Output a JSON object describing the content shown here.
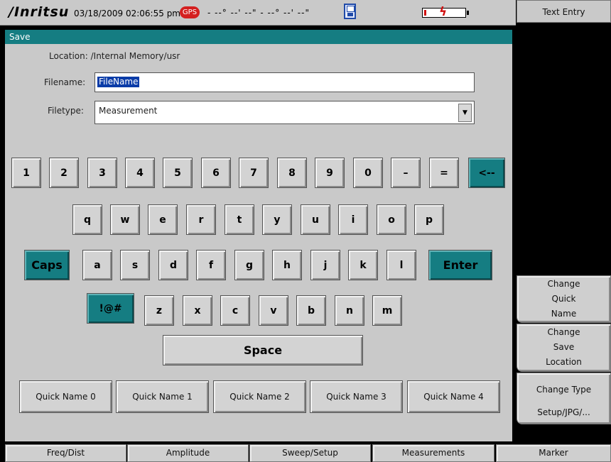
{
  "status_bar": {
    "brand": "/Inritsu",
    "datetime": "03/18/2009 02:06:55 pm",
    "gps_badge": "GPS",
    "coordinates": "- --° --' --\" - --° --' --\""
  },
  "dialog": {
    "title": "Save",
    "location": "Location: /Internal Memory/usr",
    "filename_label": "Filename:",
    "filename_value": "FileName",
    "filetype_label": "Filetype:",
    "filetype_value": "Measurement"
  },
  "keyboard": {
    "row1": [
      "1",
      "2",
      "3",
      "4",
      "5",
      "6",
      "7",
      "8",
      "9",
      "0",
      "–",
      "=",
      "<--"
    ],
    "row2": [
      "q",
      "w",
      "e",
      "r",
      "t",
      "y",
      "u",
      "i",
      "o",
      "p"
    ],
    "row3": [
      "Caps",
      "a",
      "s",
      "d",
      "f",
      "g",
      "h",
      "j",
      "k",
      "l",
      "Enter"
    ],
    "row4": [
      "!@#",
      "z",
      "x",
      "c",
      "v",
      "b",
      "n",
      "m"
    ],
    "space": "Space",
    "quick_names": [
      "Quick Name 0",
      "Quick Name 1",
      "Quick Name 2",
      "Quick Name 3",
      "Quick Name 4"
    ]
  },
  "right_menu": {
    "title": "Text Entry",
    "change_quick_name": [
      "Change",
      "Quick",
      "Name"
    ],
    "change_save_location": [
      "Change",
      "Save",
      "Location"
    ],
    "change_type": [
      "Change Type",
      "Setup/JPG/..."
    ]
  },
  "bottom_tabs": [
    "Freq/Dist",
    "Amplitude",
    "Sweep/Setup",
    "Measurements",
    "Marker"
  ],
  "colors": {
    "teal": "#157d82",
    "panel": "#c9c9c9",
    "gps": "#d42020"
  }
}
